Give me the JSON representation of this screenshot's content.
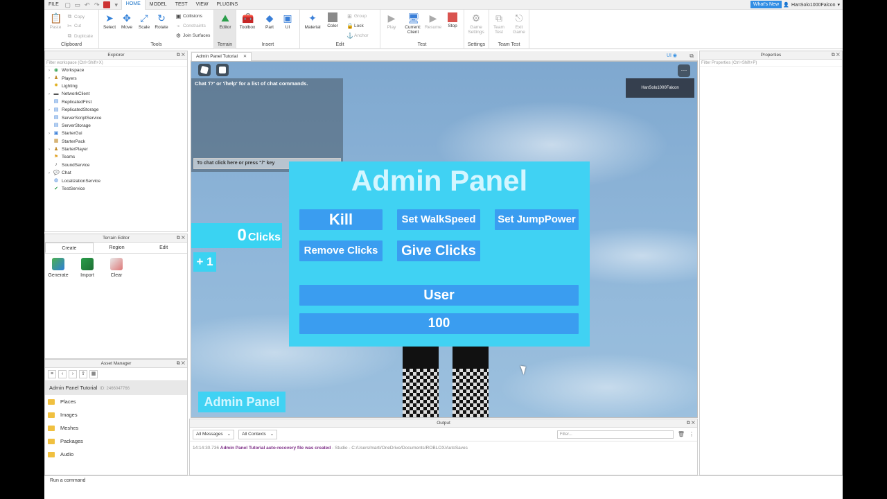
{
  "menubar": {
    "file": "FILE",
    "tabs": [
      "HOME",
      "MODEL",
      "TEST",
      "VIEW",
      "PLUGINS"
    ],
    "whats_new": "What's New",
    "username": "HanSolo1000Falcon"
  },
  "ribbon": {
    "clipboard": {
      "label": "Clipboard",
      "paste": "Paste",
      "copy": "Copy",
      "cut": "Cut",
      "duplicate": "Duplicate"
    },
    "tools": {
      "label": "Tools",
      "select": "Select",
      "move": "Move",
      "scale": "Scale",
      "rotate": "Rotate",
      "collisions": "Collisions",
      "constraints": "Constraints",
      "join_surfaces": "Join Surfaces"
    },
    "terrain": {
      "label": "Terrain",
      "editor": "Editor"
    },
    "insert": {
      "label": "Insert",
      "toolbox": "Toolbox",
      "part": "Part",
      "ui": "UI"
    },
    "edit": {
      "label": "Edit",
      "material": "Material",
      "color": "Color",
      "group": "Group",
      "lock": "Lock",
      "anchor": "Anchor"
    },
    "test": {
      "label": "Test",
      "play": "Play",
      "current_client": "Current: Client",
      "resume": "Resume",
      "stop": "Stop"
    },
    "settings": {
      "label": "Settings",
      "game_settings": "Game Settings"
    },
    "team_test": {
      "label": "Team Test",
      "team_test": "Team Test",
      "exit_game": "Exit Game"
    }
  },
  "explorer": {
    "title": "Explorer",
    "filter": "Filter workspace (Ctrl+Shift+X)",
    "items": [
      "Workspace",
      "Players",
      "Lighting",
      "NetworkClient",
      "ReplicatedFirst",
      "ReplicatedStorage",
      "ServerScriptService",
      "ServerStorage",
      "StarterGui",
      "StarterPack",
      "StarterPlayer",
      "Teams",
      "SoundService",
      "Chat",
      "LocalizationService",
      "TestService"
    ]
  },
  "terrain_editor": {
    "title": "Terrain Editor",
    "tabs": [
      "Create",
      "Region",
      "Edit"
    ],
    "tools": [
      "Generate",
      "Import",
      "Clear"
    ]
  },
  "asset_manager": {
    "title": "Asset Manager",
    "place_name": "Admin Panel Tutorial",
    "place_id": "ID: 2466047766",
    "folders": [
      "Places",
      "Images",
      "Meshes",
      "Packages",
      "Audio"
    ]
  },
  "viewport": {
    "tab": "Admin Panel Tutorial",
    "ui_toggle": "UI",
    "chat_hint": "Chat '/?' or '/help' for a list of chat commands.",
    "chat_input": "To chat click here or press \"/\" key",
    "leaderboard_user": "HanSolo1000Falcon",
    "clicks_count": "0",
    "clicks_label": "Clicks",
    "plus_one": "+ 1",
    "admin_toggle": "Admin Panel"
  },
  "admin_panel": {
    "title": "Admin Panel",
    "kill": "Kill",
    "set_walkspeed": "Set WalkSpeed",
    "set_jumppower": "Set JumpPower",
    "remove_clicks": "Remove Clicks",
    "give_clicks": "Give Clicks",
    "user_field": "User",
    "amount_field": "100"
  },
  "properties": {
    "title": "Properties",
    "filter": "Filter Properties (Ctrl+Shift+P)"
  },
  "output": {
    "title": "Output",
    "messages_filter": "All Messages",
    "contexts_filter": "All Contexts",
    "filter_placeholder": "Filter...",
    "log_time": "14:14:30.736",
    "log_message": "Admin Panel Tutorial auto-recovery file was created",
    "log_source": "- Studio - C:/Users/marti/OneDrive/Documents/ROBLOX/AutoSaves"
  },
  "command_bar": {
    "placeholder": "Run a command"
  },
  "colors": {
    "panel_bg": "#40d2f3",
    "button_bg": "#3a9df0",
    "title_text": "#d4f6ff",
    "accent": "#2f8de4"
  }
}
